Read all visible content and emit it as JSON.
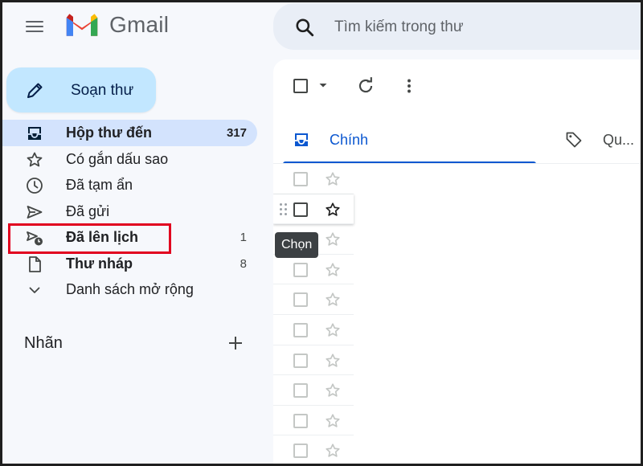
{
  "app": {
    "name": "Gmail"
  },
  "colors": {
    "compose_bg": "#c2e7ff",
    "active_nav_bg": "#d3e3fd",
    "accent_blue": "#0b57d0",
    "highlight_red": "#e1001f"
  },
  "search": {
    "placeholder": "Tìm kiếm trong thư",
    "icon": "search-icon"
  },
  "compose": {
    "label": "Soạn thư",
    "icon": "pencil-icon"
  },
  "nav": {
    "items": [
      {
        "label": "Hộp thư đến",
        "count": "317",
        "icon": "inbox-icon"
      },
      {
        "label": "Có gắn dấu sao",
        "count": "",
        "icon": "star-icon"
      },
      {
        "label": "Đã tạm ẩn",
        "count": "",
        "icon": "clock-icon"
      },
      {
        "label": "Đã gửi",
        "count": "",
        "icon": "send-icon"
      },
      {
        "label": "Đã lên lịch",
        "count": "1",
        "icon": "scheduled-send-icon"
      },
      {
        "label": "Thư nháp",
        "count": "8",
        "icon": "draft-icon"
      },
      {
        "label": "Danh sách mở rộng",
        "count": "",
        "icon": "chevron-down-icon"
      }
    ]
  },
  "labels": {
    "title": "Nhãn",
    "add_icon": "plus-icon"
  },
  "toolbar": {
    "select_icon": "checkbox-icon",
    "caret_icon": "caret-down-icon",
    "refresh_icon": "refresh-icon",
    "more_icon": "more-vert-icon"
  },
  "tabs": [
    {
      "label": "Chính",
      "icon": "inbox-tab-icon",
      "selected": true
    },
    {
      "label": "Qu...",
      "icon": "tag-icon",
      "selected": false
    }
  ],
  "tooltip": {
    "text": "Chọn"
  }
}
